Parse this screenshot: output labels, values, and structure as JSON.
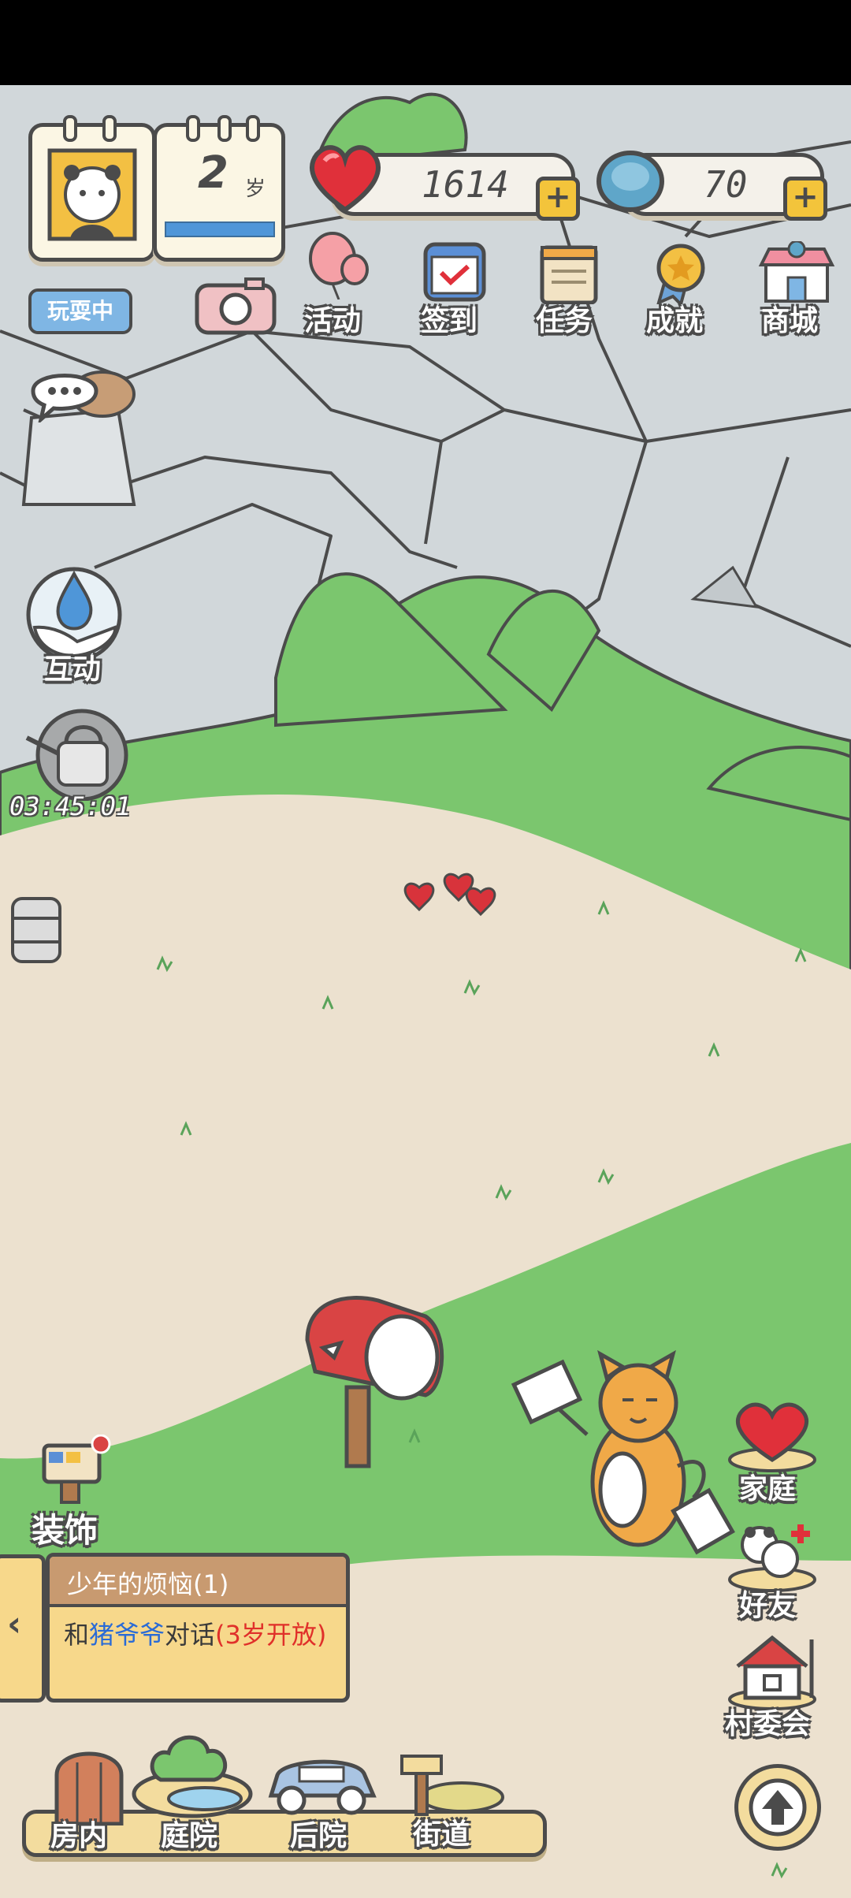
{
  "hud": {
    "age_number": "2",
    "age_unit": "岁",
    "status_badge": "玩耍中",
    "hearts": "1614",
    "bottlecaps": "70"
  },
  "menu": {
    "activity": "活动",
    "checkin": "签到",
    "tasks": "任务",
    "achievements": "成就",
    "shop": "商城"
  },
  "left_actions": {
    "interact": "互动",
    "timer": "03:45:01"
  },
  "decor_label": "装饰",
  "quest": {
    "title": "少年的烦恼(1)",
    "text_pre": "和",
    "text_npc": "猪爷爷",
    "text_mid": "对话",
    "text_req": "(3岁开放)"
  },
  "right_actions": {
    "family": "家庭",
    "friends": "好友",
    "village": "村委会"
  },
  "bottom_nav": [
    "房内",
    "庭院",
    "后院",
    "街道"
  ],
  "colors": {
    "heart_red": "#e0303a",
    "grass_green": "#7bc66e",
    "rock_gray": "#d1d7da",
    "ground_beige": "#ece1cf"
  }
}
